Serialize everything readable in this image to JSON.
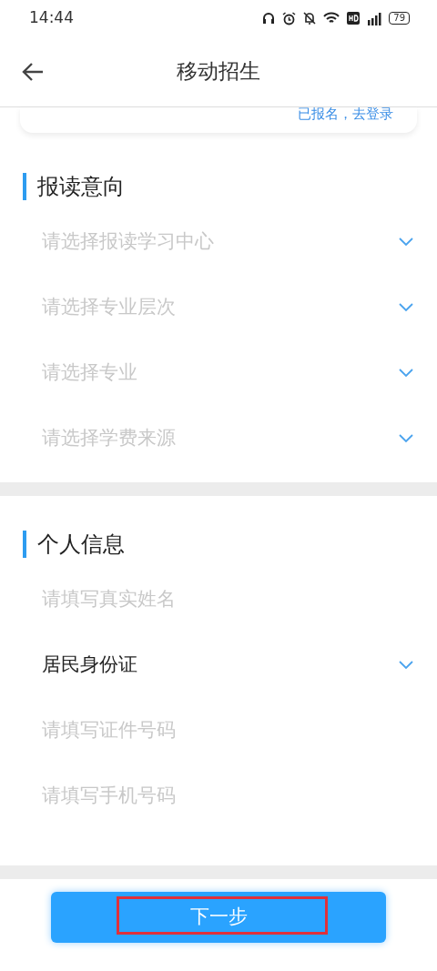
{
  "status_bar": {
    "time": "14:44",
    "battery": "79"
  },
  "header": {
    "title": "移动招生"
  },
  "login_card": {
    "link": "已报名，去登录"
  },
  "sections": [
    {
      "title": "报读意向",
      "fields": [
        {
          "kind": "select",
          "placeholder": "请选择报读学习中心"
        },
        {
          "kind": "select",
          "placeholder": "请选择专业层次"
        },
        {
          "kind": "select",
          "placeholder": "请选择专业"
        },
        {
          "kind": "select",
          "placeholder": "请选择学费来源"
        }
      ]
    },
    {
      "title": "个人信息",
      "fields": [
        {
          "kind": "input",
          "placeholder": "请填写真实姓名"
        },
        {
          "kind": "select",
          "value": "居民身份证"
        },
        {
          "kind": "input",
          "placeholder": "请填写证件号码"
        },
        {
          "kind": "input",
          "placeholder": "请填写手机号码"
        }
      ]
    }
  ],
  "next_button": {
    "label": "下一步",
    "highlighted": true
  }
}
